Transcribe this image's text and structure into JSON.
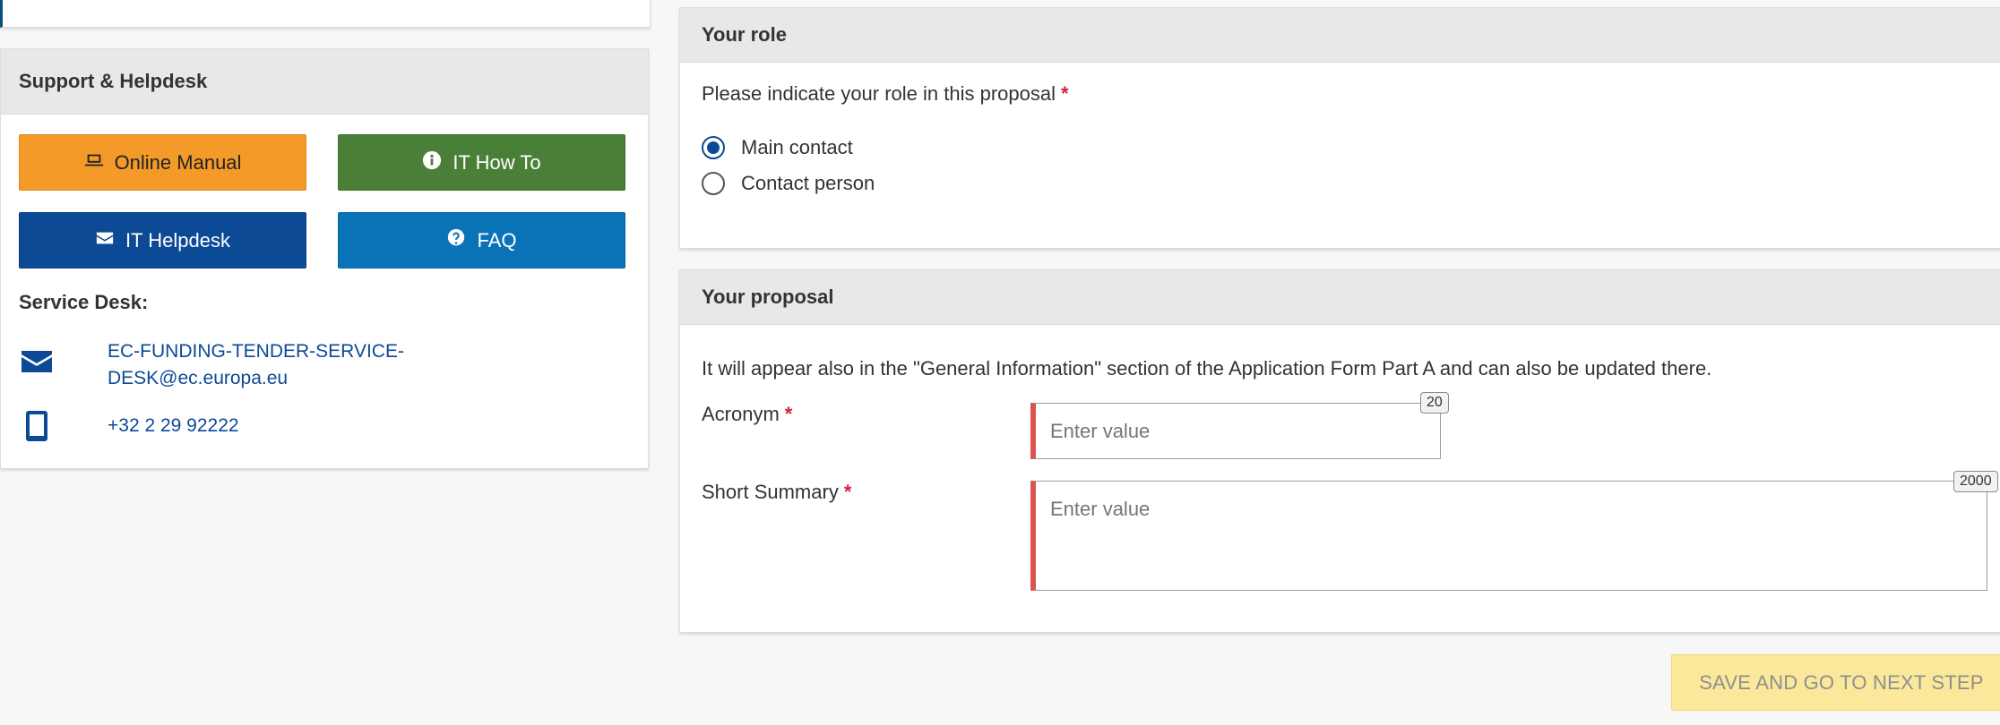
{
  "support": {
    "title": "Support & Helpdesk",
    "buttons": {
      "online_manual": "Online Manual",
      "it_how_to": "IT How To",
      "it_helpdesk": "IT Helpdesk",
      "faq": "FAQ"
    },
    "service_desk_title": "Service Desk:",
    "email_line1": "EC-FUNDING-TENDER-SERVICE-",
    "email_line2": "DESK@ec.europa.eu",
    "phone": "+32 2 29 92222",
    "icons": [
      "laptop-icon",
      "info-icon",
      "envelope-icon",
      "question-icon",
      "mobile-phone-icon"
    ]
  },
  "role": {
    "title": "Your role",
    "prompt": "Please indicate your role in this proposal",
    "required_mark": "*",
    "options": [
      "Main contact",
      "Contact person"
    ],
    "selected": "Main contact"
  },
  "proposal": {
    "title": "Your proposal",
    "note": "It will appear also in the \"General Information\" section of the Application Form Part A and can also be updated there.",
    "acronym_label": "Acronym",
    "acronym_placeholder": "Enter value",
    "acronym_max": "20",
    "summary_label": "Short Summary",
    "summary_placeholder": "Enter value",
    "summary_max": "2000",
    "required_mark": "*"
  },
  "footer": {
    "save_label": "SAVE AND GO TO NEXT STEP"
  },
  "colors": {
    "orange": "#f39a29",
    "green": "#4a7f38",
    "dark_blue": "#0c4a96",
    "blue": "#0a73b8",
    "required_red": "#d4213d",
    "save_yellow": "#fbe89a"
  }
}
